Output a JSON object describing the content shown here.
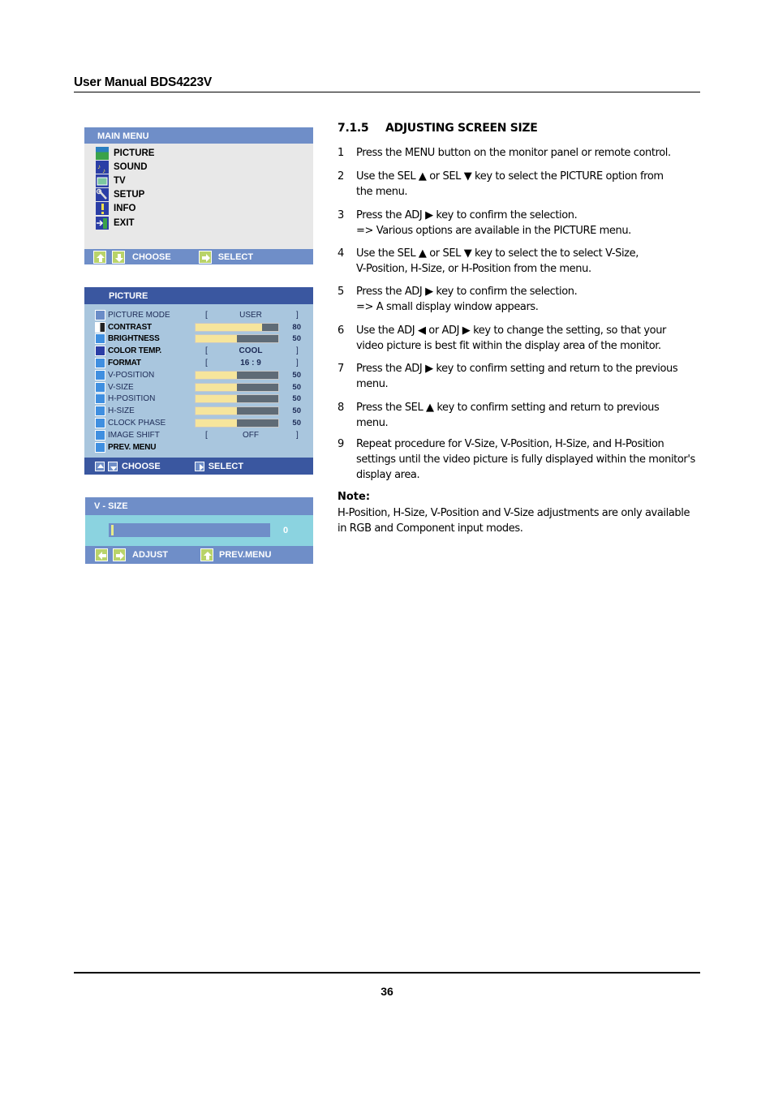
{
  "header": {
    "title": "User Manual BDS4223V"
  },
  "footer": {
    "page_number": "36"
  },
  "main_menu": {
    "title": "MAIN  MENU",
    "items": [
      {
        "label": "PICTURE",
        "icon": "picture-icon"
      },
      {
        "label": "SOUND",
        "icon": "sound-icon"
      },
      {
        "label": "TV",
        "icon": "tv-icon"
      },
      {
        "label": "SETUP",
        "icon": "setup-icon"
      },
      {
        "label": "INFO",
        "icon": "info-icon"
      },
      {
        "label": "EXIT",
        "icon": "exit-icon"
      }
    ],
    "footer": {
      "choose": "CHOOSE",
      "select": "SELECT"
    }
  },
  "picture_menu": {
    "title": "PICTURE",
    "rows": [
      {
        "label": "PICTURE MODE",
        "type": "option",
        "value": "USER"
      },
      {
        "label": "CONTRAST",
        "type": "bar",
        "value": 80
      },
      {
        "label": "BRIGHTNESS",
        "type": "bar",
        "value": 50
      },
      {
        "label": "COLOR  TEMP.",
        "type": "option",
        "value": "COOL"
      },
      {
        "label": "FORMAT",
        "type": "option",
        "value": "16 : 9"
      },
      {
        "label": "V-POSITION",
        "type": "bar",
        "value": 50
      },
      {
        "label": "V-SIZE",
        "type": "bar",
        "value": 50
      },
      {
        "label": "H-POSITION",
        "type": "bar",
        "value": 50
      },
      {
        "label": "H-SIZE",
        "type": "bar",
        "value": 50
      },
      {
        "label": "CLOCK PHASE",
        "type": "bar",
        "value": 50
      },
      {
        "label": "IMAGE SHIFT",
        "type": "option",
        "value": "OFF"
      },
      {
        "label": "PREV.  MENU",
        "type": "link"
      }
    ],
    "bracket_left": "[",
    "bracket_right": "]",
    "footer": {
      "choose": "CHOOSE",
      "select": "SELECT"
    }
  },
  "vsize_window": {
    "title": "V - SIZE",
    "value": "0",
    "value_fraction": 0,
    "footer": {
      "adjust": "ADJUST",
      "prev_menu": "PREV.MENU"
    }
  },
  "section": {
    "number": "7.1.5",
    "title": "ADJUSTING SCREEN SIZE",
    "steps": [
      {
        "n": "1",
        "lines": [
          "Press the MENU button on the monitor panel or remote control."
        ]
      },
      {
        "n": "2",
        "lines": [
          "Use the SEL ▲ or SEL ▼ key to select the PICTURE option from",
          "the menu."
        ]
      },
      {
        "n": "3",
        "lines": [
          "Press the ADJ ▶ key to confirm the selection.",
          "=> Various options are available in the PICTURE menu."
        ]
      },
      {
        "n": "4",
        "lines": [
          "Use the SEL ▲ or SEL ▼ key to select the  to select V-Size,",
          "V-Position, H-Size, or H-Position from the menu."
        ]
      },
      {
        "n": "5",
        "lines": [
          "Press the ADJ ▶ key to confirm the selection.",
          "=> A small display window appears."
        ]
      },
      {
        "n": "6",
        "lines": [
          "Use the ADJ ◀ or ADJ ▶ key to change the setting, so that your",
          "video picture is best fit within the display area of the monitor."
        ]
      },
      {
        "n": "7",
        "lines": [
          "Press the ADJ ▶ key to confirm setting and return to the previous",
          "menu."
        ]
      },
      {
        "n": "8",
        "lines": [
          "Press the SEL ▲ key to confirm setting and return to previous",
          "menu."
        ]
      },
      {
        "n": "9",
        "lines": [
          "Repeat procedure for V-Size, V-Position, H-Size, and H-Position",
          "settings until the video picture is fully displayed within the monitor's",
          "display area."
        ]
      }
    ],
    "note_label": "Note:",
    "note_lines": [
      "H-Position, H-Size, V-Position and V-Size adjustments are only available",
      "in RGB and Component input modes."
    ]
  },
  "colors": {
    "osd_header_blue": "#6f8ec8",
    "osd_dark_blue": "#3a57a0",
    "osd_light_blue": "#a9c6de",
    "osd_cyan": "#8bd3e0",
    "bar_fill": "#f6e59c",
    "bar_track": "#5f6b76"
  }
}
